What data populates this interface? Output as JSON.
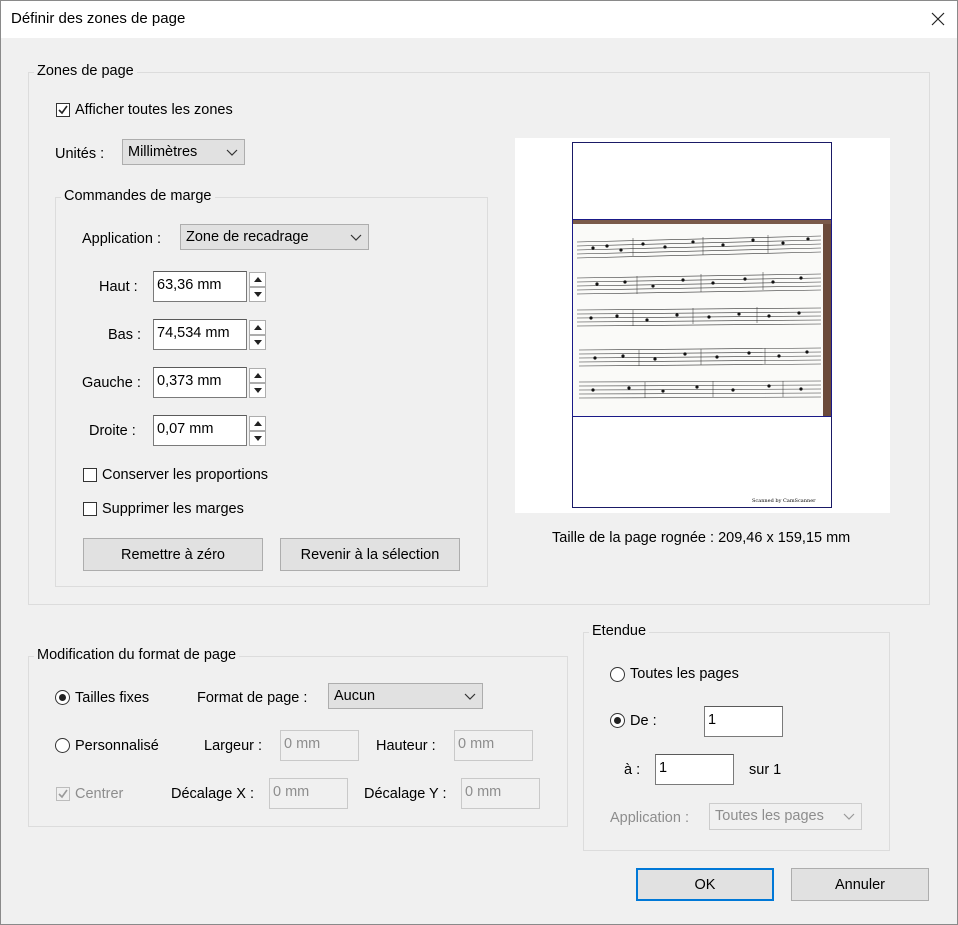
{
  "window": {
    "title": "Définir des zones de page"
  },
  "zones": {
    "legend": "Zones de page",
    "show_all_label": "Afficher toutes les zones",
    "show_all_checked": true,
    "units_label": "Unités :",
    "units_value": "Millimètres"
  },
  "margins": {
    "legend": "Commandes de marge",
    "application_label": "Application :",
    "application_value": "Zone de recadrage",
    "top_label": "Haut :",
    "top_value": "63,36 mm",
    "bottom_label": "Bas :",
    "bottom_value": "74,534 mm",
    "left_label": "Gauche :",
    "left_value": "0,373 mm",
    "right_label": "Droite :",
    "right_value": "0,07 mm",
    "keep_ratio_label": "Conserver les proportions",
    "remove_margins_label": "Supprimer les marges",
    "reset_button": "Remettre à zéro",
    "revert_button": "Revenir à la sélection"
  },
  "preview": {
    "footer_text": "Scanned by CamScanner",
    "size_label": "Taille de la page rognée : 209,46 x 159,15 mm"
  },
  "format": {
    "legend": "Modification du format de page",
    "fixed_label": "Tailles fixes",
    "page_format_label": "Format de page :",
    "page_format_value": "Aucun",
    "custom_label": "Personnalisé",
    "width_label": "Largeur :",
    "width_value": "0 mm",
    "height_label": "Hauteur :",
    "height_value": "0 mm",
    "center_label": "Centrer",
    "offset_x_label": "Décalage X :",
    "offset_x_value": "0 mm",
    "offset_y_label": "Décalage Y :",
    "offset_y_value": "0 mm"
  },
  "range": {
    "legend": "Etendue",
    "all_pages_label": "Toutes les pages",
    "from_label": "De :",
    "from_value": "1",
    "to_label": "à :",
    "to_value": "1",
    "of_label": "sur 1",
    "application_label": "Application :",
    "application_value": "Toutes les pages"
  },
  "buttons": {
    "ok": "OK",
    "cancel": "Annuler"
  },
  "colors": {
    "accent": "#0078d7",
    "frame": "#1a1a66"
  }
}
